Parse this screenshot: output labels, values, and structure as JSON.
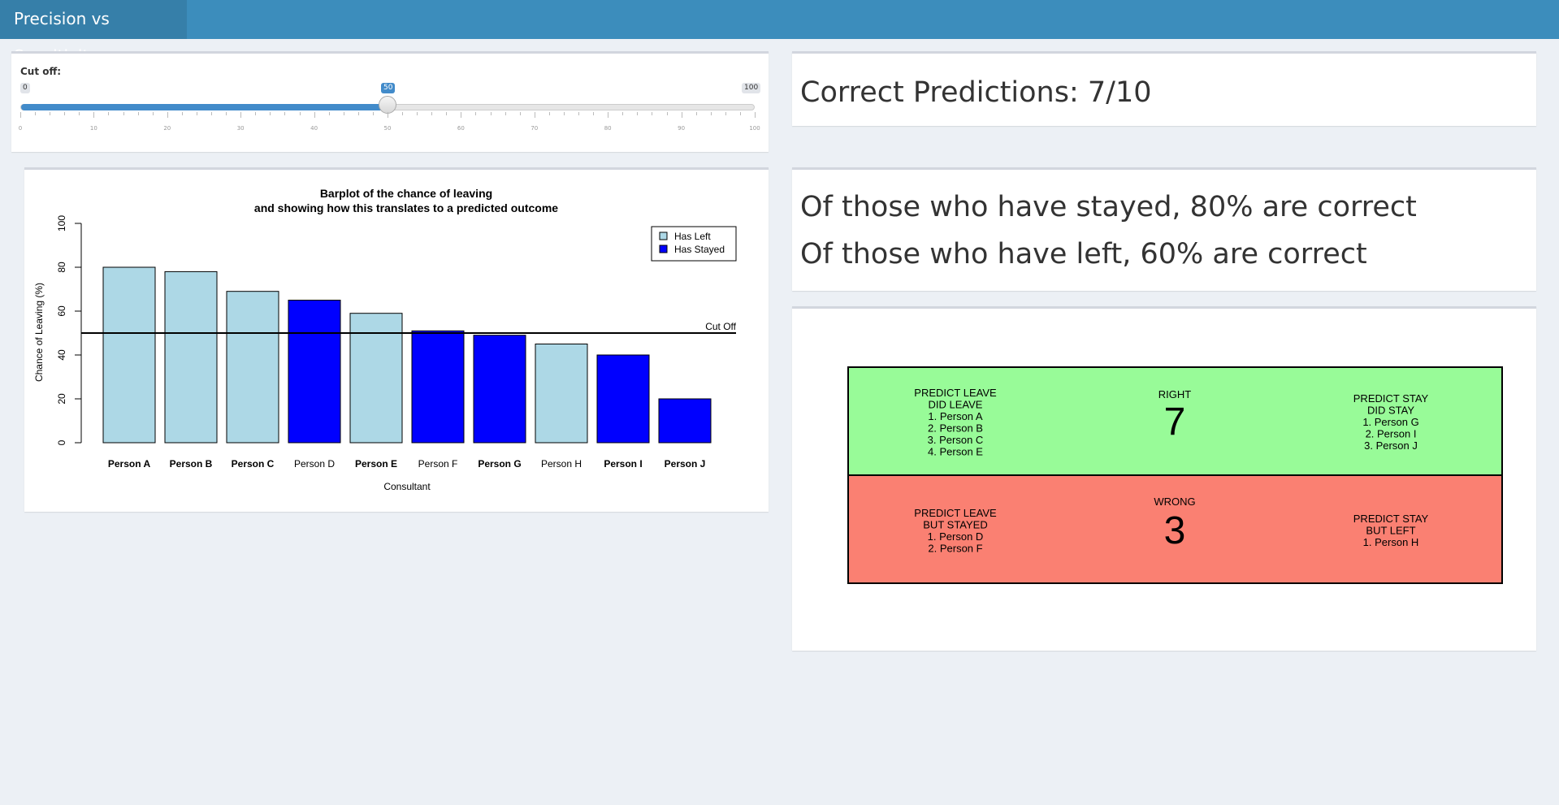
{
  "header": {
    "title": "Precision vs Sensitivity"
  },
  "slider": {
    "label": "Cut off:",
    "min": 0,
    "max": 100,
    "value": 50,
    "min_label": "0",
    "max_label": "100",
    "value_label": "50",
    "grid_labels": [
      "0",
      "10",
      "20",
      "30",
      "40",
      "50",
      "60",
      "70",
      "80",
      "90",
      "100"
    ]
  },
  "summary": {
    "correct": "Correct Predictions: 7/10"
  },
  "rates": {
    "stayed": "Of those who have stayed, 80% are correct",
    "left": "Of those who have left, 60% are correct"
  },
  "colors": {
    "has_left": "#add8e6",
    "has_stayed": "#0000ff",
    "right": "#98fb98",
    "wrong": "#fa8072"
  },
  "chart_data": {
    "type": "bar",
    "title": "Barplot of the chance of leaving",
    "subtitle": "and showing how this translates to a predicted outcome",
    "xlabel": "Consultant",
    "ylabel": "Chance of Leaving (%)",
    "ylim": [
      0,
      100
    ],
    "yticks": [
      "0",
      "20",
      "40",
      "60",
      "80",
      "100"
    ],
    "categories": [
      "Person A",
      "Person B",
      "Person C",
      "Person D",
      "Person E",
      "Person F",
      "Person G",
      "Person H",
      "Person I",
      "Person J"
    ],
    "values": [
      80,
      78,
      69,
      65,
      59,
      51,
      49,
      45,
      40,
      20
    ],
    "status": [
      "left",
      "left",
      "left",
      "stayed",
      "left",
      "stayed",
      "stayed",
      "left",
      "stayed",
      "stayed"
    ],
    "bold": [
      true,
      true,
      true,
      false,
      true,
      false,
      true,
      false,
      true,
      true
    ],
    "legend": [
      "Has Left",
      "Has Stayed"
    ],
    "legend_position": "top-right",
    "cutoff": 50,
    "cutoff_label": "Cut Off"
  },
  "matrix": {
    "right": {
      "label": "RIGHT",
      "count": "7",
      "left_lines": [
        "PREDICT LEAVE",
        "DID LEAVE",
        "1. Person A",
        "2. Person B",
        "3. Person C",
        "4. Person E"
      ],
      "right_lines": [
        "PREDICT STAY",
        "DID STAY",
        "1. Person G",
        "2. Person I",
        "3. Person J"
      ]
    },
    "wrong": {
      "label": "WRONG",
      "count": "3",
      "left_lines": [
        "PREDICT LEAVE",
        "BUT STAYED",
        "1. Person D",
        "2. Person F"
      ],
      "right_lines": [
        "PREDICT STAY",
        "BUT LEFT",
        "1. Person H"
      ]
    }
  }
}
